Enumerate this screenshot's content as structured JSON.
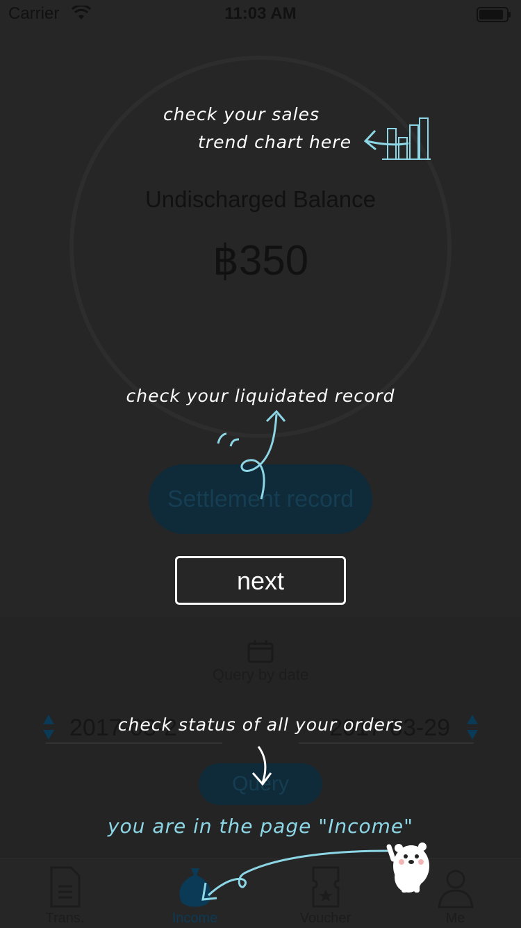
{
  "status_bar": {
    "carrier": "Carrier",
    "time": "11:03 AM"
  },
  "balance": {
    "title": "Undischarged Balance",
    "amount": "฿350"
  },
  "settlement_button": "Settlement record",
  "query": {
    "label": "Query by date",
    "start_date": "2017-03-2",
    "end_date": "2017-03-29",
    "button": "Query"
  },
  "tabs": [
    {
      "label": "Trans.",
      "icon": "document-icon"
    },
    {
      "label": "Income",
      "icon": "money-bag-icon",
      "active": true
    },
    {
      "label": "Voucher",
      "icon": "voucher-icon"
    },
    {
      "label": "Me",
      "icon": "person-icon"
    }
  ],
  "tutorial": {
    "note_chart_line1": "check your sales",
    "note_chart_line2": "trend chart here",
    "note_record": "check your liquidated record",
    "next_button": "next",
    "note_orders": "check status of all your orders",
    "note_page": "you are in the page \"Income\""
  },
  "colors": {
    "accent": "#0a4a6a",
    "hint": "#8dd6e6",
    "overlay": "#262626"
  }
}
